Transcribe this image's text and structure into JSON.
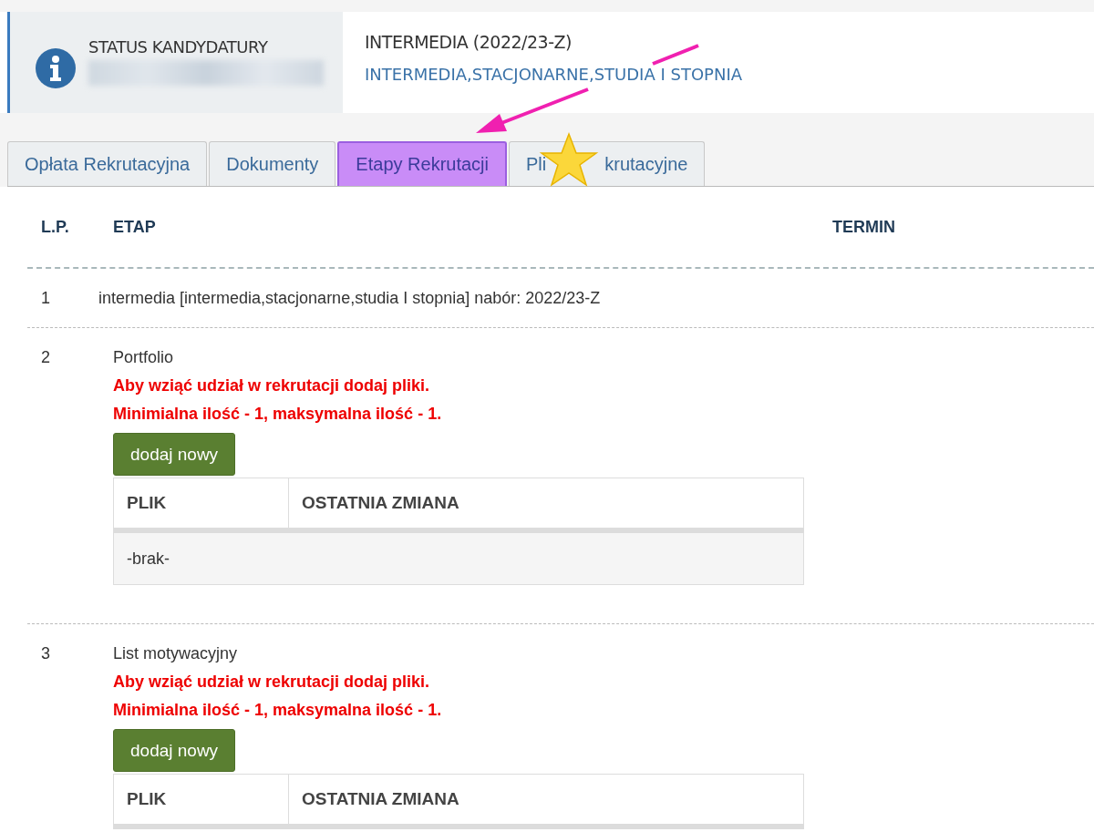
{
  "status": {
    "label": "STATUS KANDYDATURY"
  },
  "program": {
    "title": "INTERMEDIA (2022/23-Z)",
    "subtitle": "INTERMEDIA,STACJONARNE,STUDIA I STOPNIA"
  },
  "tabs": [
    {
      "label_parts": [
        "Opłata Rekrutacyjna"
      ],
      "selected": false
    },
    {
      "label_parts": [
        "Dokumenty"
      ],
      "selected": false
    },
    {
      "label_parts": [
        "Etapy Rekrutacji"
      ],
      "selected": true
    },
    {
      "label_parts": [
        "Pli",
        "krutacyjne"
      ],
      "selected": false
    }
  ],
  "table": {
    "columns": [
      "L.P.",
      "ETAP",
      "TERMIN"
    ],
    "rows": [
      {
        "kind": "text",
        "number": "1",
        "text": "intermedia [intermedia,stacjonarne,studia I stopnia] nabór: 2022/23-Z"
      },
      {
        "kind": "upload",
        "number": "2",
        "name": "Portfolio",
        "warnings": [
          "Aby wziąć udział w rekrutacji dodaj pliki.",
          "Minimialna ilość - 1, maksymalna ilość - 1."
        ],
        "button": "dodaj nowy",
        "file_columns": [
          "PLIK",
          "OSTATNIA ZMIANA"
        ],
        "file_rows": [
          "-brak-"
        ]
      },
      {
        "kind": "upload",
        "number": "3",
        "name": "List motywacyjny",
        "warnings": [
          "Aby wziąć udział w rekrutacji dodaj pliki.",
          "Minimialna ilość - 1, maksymalna ilość - 1."
        ],
        "button": "dodaj nowy",
        "file_columns": [
          "PLIK",
          "OSTATNIA ZMIANA"
        ]
      }
    ]
  }
}
